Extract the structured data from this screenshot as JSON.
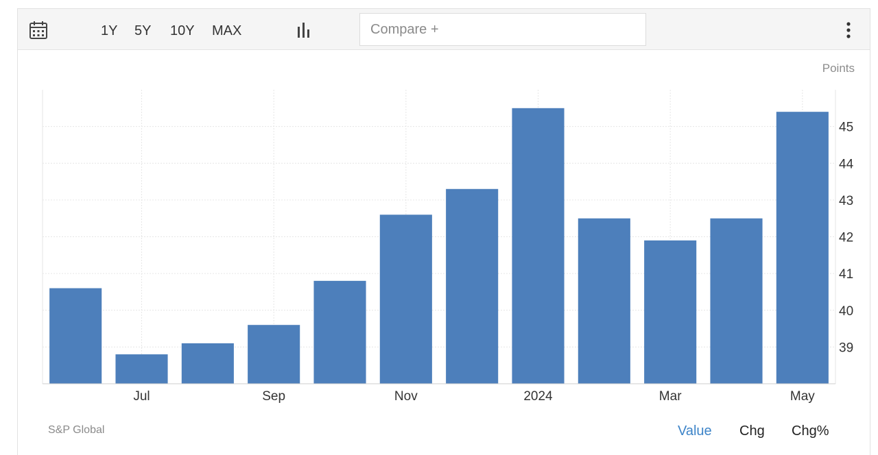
{
  "toolbar": {
    "icons": {
      "calendar": "calendar-icon",
      "chart_type": "bar-chart-icon",
      "menu": "kebab-menu-icon"
    },
    "ranges": [
      "1Y",
      "5Y",
      "10Y",
      "MAX"
    ],
    "compare_placeholder": "Compare +"
  },
  "units_label": "Points",
  "source_label": "S&P Global",
  "footer": {
    "value_label": "Value",
    "chg_label": "Chg",
    "chgpct_label": "Chg%"
  },
  "colors": {
    "bar": "#4d7fbb",
    "active_link": "#3d84c8",
    "grid": "#e6e6e6"
  },
  "chart_data": {
    "type": "bar",
    "categories": [
      "Jun 2023",
      "Jul 2023",
      "Aug 2023",
      "Sep 2023",
      "Oct 2023",
      "Nov 2023",
      "Dec 2023",
      "Jan 2024",
      "Feb 2024",
      "Mar 2024",
      "Apr 2024",
      "May 2024"
    ],
    "values": [
      40.6,
      38.8,
      39.1,
      39.6,
      40.8,
      42.6,
      43.3,
      45.5,
      42.5,
      41.9,
      42.5,
      45.4
    ],
    "x_tick_labels": [
      {
        "category_index": 1,
        "label": "Jul"
      },
      {
        "category_index": 3,
        "label": "Sep"
      },
      {
        "category_index": 5,
        "label": "Nov"
      },
      {
        "category_index": 7,
        "label": "2024"
      },
      {
        "category_index": 9,
        "label": "Mar"
      },
      {
        "category_index": 11,
        "label": "May"
      }
    ],
    "y_ticks": [
      39,
      40,
      41,
      42,
      43,
      44,
      45
    ],
    "ylim": [
      38.0,
      46.0
    ],
    "y_axis_position": "right",
    "grid": true,
    "legend": false
  }
}
